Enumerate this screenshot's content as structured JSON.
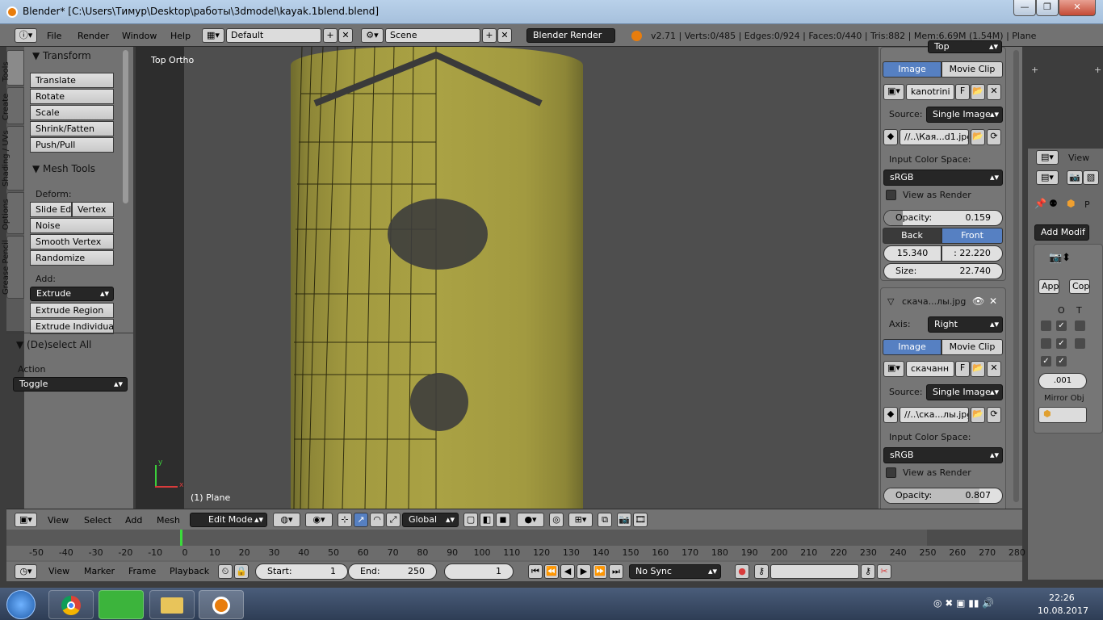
{
  "titlebar": {
    "title": "Blender* [C:\\Users\\Тимур\\Desktop\\работы\\3dmodel\\kayak.1blend.blend]"
  },
  "info": {
    "menus": [
      "File",
      "Render",
      "Window",
      "Help"
    ],
    "layout": "Default",
    "scene": "Scene",
    "engine": "Blender Render",
    "stats": "v2.71 | Verts:0/485 | Edges:0/924 | Faces:0/440 | Tris:882 | Mem:6.69M (1.54M) | Plane"
  },
  "tabs": [
    "Tools",
    "Create",
    "Shading / UVs",
    "Options",
    "Grease Pencil"
  ],
  "tools": {
    "transform_title": "Transform",
    "transform": [
      "Translate",
      "Rotate",
      "Scale",
      "Shrink/Fatten",
      "Push/Pull"
    ],
    "mesh_title": "Mesh Tools",
    "deform_label": "Deform:",
    "slide_edge": "Slide Ed",
    "vertex": "Vertex",
    "deform": [
      "Noise",
      "Smooth Vertex",
      "Randomize"
    ],
    "add_label": "Add:",
    "extrude": "Extrude",
    "add": [
      "Extrude Region",
      "Extrude Individual"
    ],
    "deselect_title": "(De)select All",
    "action_label": "Action",
    "action_value": "Toggle"
  },
  "viewport": {
    "view_name": "Top Ortho",
    "object_label": "(1) Plane",
    "axis_y": "y",
    "axis_x": "x"
  },
  "bg1": {
    "axis_value": "Top",
    "image_tab": "Image",
    "movie_tab": "Movie Clip",
    "image_name": "kanotrini",
    "f": "F",
    "source_label": "Source:",
    "source_value": "Single Image",
    "path": "//..\\Кая...d1.jpg",
    "color_space_label": "Input Color Space:",
    "color_space": "sRGB",
    "view_as_render": "View as Render",
    "opacity_label": "Opacity:",
    "opacity": "0.159",
    "back": "Back",
    "front": "Front",
    "x": "15.340",
    "y": "22.220",
    "size_label": "Size:",
    "size": "22.740"
  },
  "bg2": {
    "name": "скача...лы.jpg",
    "axis_label": "Axis:",
    "axis_value": "Right",
    "image_tab": "Image",
    "movie_tab": "Movie Clip",
    "image_name": "скачанн",
    "f": "F",
    "source_label": "Source:",
    "source_value": "Single Image",
    "path": "//..\\ска...лы.jpg",
    "color_space_label": "Input Color Space:",
    "color_space": "sRGB",
    "view_as_render": "View as Render",
    "opacity_label": "Opacity:",
    "opacity": "0.807"
  },
  "props": {
    "view": "View",
    "p": "P",
    "add_modifier": "Add Modif",
    "apply": "App",
    "copy": "Cop",
    "o": "O",
    "t": "T",
    "value": ".001",
    "mirror": "Mirror Obj"
  },
  "vpheader": {
    "menus": [
      "View",
      "Select",
      "Add",
      "Mesh"
    ],
    "mode": "Edit Mode",
    "orientation": "Global"
  },
  "timeline": {
    "ticks": [
      "-50",
      "-40",
      "-30",
      "-20",
      "-10",
      "0",
      "10",
      "20",
      "30",
      "40",
      "50",
      "60",
      "70",
      "80",
      "90",
      "100",
      "110",
      "120",
      "130",
      "140",
      "150",
      "160",
      "170",
      "180",
      "190",
      "200",
      "210",
      "220",
      "230",
      "240",
      "250",
      "260",
      "270",
      "280"
    ],
    "menus": [
      "View",
      "Marker",
      "Frame",
      "Playback"
    ],
    "start_label": "Start:",
    "start": "1",
    "end_label": "End:",
    "end": "250",
    "current": "1",
    "sync": "No Sync"
  },
  "taskbar": {
    "time": "22:26",
    "date": "10.08.2017"
  }
}
